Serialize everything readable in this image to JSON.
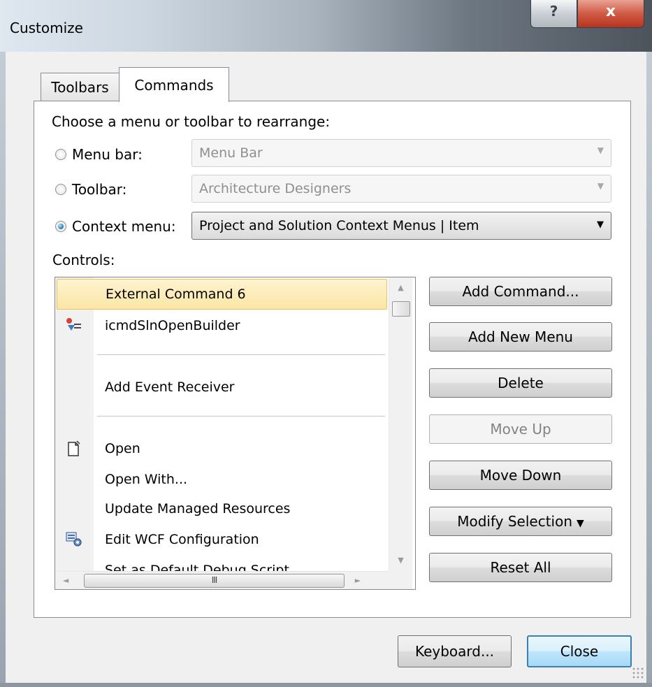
{
  "window": {
    "title": "Customize",
    "help_glyph": "?",
    "close_glyph": "x"
  },
  "tabs": [
    {
      "label": "Toolbars",
      "selected": false
    },
    {
      "label": "Commands",
      "selected": true
    }
  ],
  "commands": {
    "heading": "Choose a menu or toolbar to rearrange:",
    "options": [
      {
        "label": "Menu bar:",
        "value": "Menu Bar",
        "checked": false,
        "enabled": false
      },
      {
        "label": "Toolbar:",
        "value": "Architecture Designers",
        "checked": false,
        "enabled": false
      },
      {
        "label": "Context menu:",
        "value": "Project and Solution Context Menus | Item",
        "checked": true,
        "enabled": true
      }
    ],
    "controls_label": "Controls:",
    "dropdown_glyph": "▼",
    "list_items": [
      {
        "text": "External Command 6",
        "icon": "",
        "selected": true
      },
      {
        "text": "icmdSlnOpenBuilder",
        "icon": "builder-icon",
        "selected": false
      },
      {
        "text": "Add Event Receiver",
        "icon": "",
        "selected": false
      },
      {
        "text": "Open",
        "icon": "open-document-icon",
        "selected": false
      },
      {
        "text": "Open With...",
        "icon": "",
        "selected": false
      },
      {
        "text": "Update Managed Resources",
        "icon": "",
        "selected": false
      },
      {
        "text": "Edit WCF Configuration",
        "icon": "wcf-configuration-icon",
        "selected": false
      },
      {
        "text": "Set as Default Debug Script",
        "icon": "",
        "selected": false
      }
    ],
    "scroll_glyphs": {
      "up": "▲",
      "down": "▼",
      "left": "◄",
      "right": "►",
      "thumb_grip": "III"
    },
    "buttons": [
      {
        "label": "Add Command...",
        "enabled": true
      },
      {
        "label": "Add New Menu",
        "enabled": true
      },
      {
        "label": "Delete",
        "enabled": true
      },
      {
        "label": "Move Up",
        "enabled": false
      },
      {
        "label": "Move Down",
        "enabled": true
      },
      {
        "label": "Modify Selection",
        "enabled": true,
        "dropdown": true
      },
      {
        "label": "Reset All",
        "enabled": true
      }
    ]
  },
  "footer": {
    "keyboard_label": "Keyboard...",
    "close_label": "Close"
  },
  "colors": {
    "selection_fill": "#fce6a4",
    "selection_border": "#e5c365",
    "default_button_border": "#3c7fb1",
    "close_caption_button": "#cf5a45"
  }
}
